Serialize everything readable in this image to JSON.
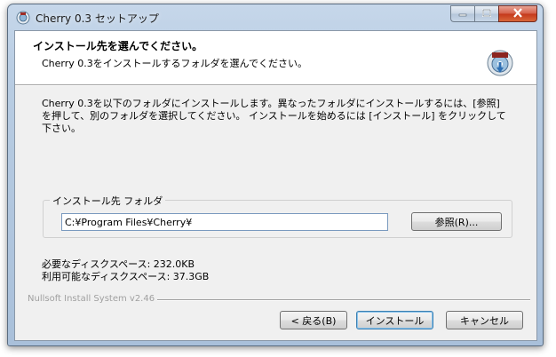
{
  "window": {
    "title": "Cherry 0.3 セットアップ"
  },
  "header": {
    "title": "インストール先を選んでください。",
    "subtitle": "Cherry 0.3をインストールするフォルダを選んでください。"
  },
  "intro_text": "Cherry 0.3を以下のフォルダにインストールします。異なったフォルダにインストールするには、[参照] を押して、別のフォルダを選択してください。 インストールを始めるには [インストール] をクリックして下さい。",
  "destination": {
    "legend": "インストール先 フォルダ",
    "path_value": "C:¥Program Files¥Cherry¥",
    "browse_label": "参照(R)..."
  },
  "disk": {
    "required": "必要なディスクスペース: 232.0KB",
    "available": "利用可能なディスクスペース: 37.3GB"
  },
  "branding": "Nullsoft Install System v2.46",
  "buttons": {
    "back": "< 戻る(B)",
    "install": "インストール",
    "cancel": "キャンセル"
  },
  "colors": {
    "titlebar": "#b9cde3",
    "close_button": "#c4381b",
    "dialog_bg": "#f0f0f0",
    "default_button_border": "#3c7fb1"
  },
  "icons": {
    "title": "installer-icon",
    "header": "installer-disk-icon",
    "minimize": "minimize-icon",
    "maximize": "maximize-icon",
    "close": "close-icon"
  }
}
